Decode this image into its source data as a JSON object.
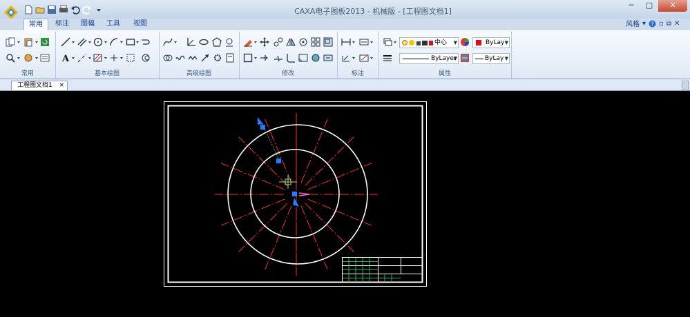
{
  "window": {
    "title": "CAXA电子图板2013 - 机械版 - [工程图文档1]",
    "minimize": "─",
    "maximize": "□",
    "close": "✕"
  },
  "quick_access": [
    "new-icon",
    "open-icon",
    "save-icon",
    "print-icon",
    "undo-icon",
    "redo-icon",
    "dropdown-icon"
  ],
  "tabs": [
    {
      "label": "常用",
      "active": true
    },
    {
      "label": "标注",
      "active": false
    },
    {
      "label": "图幅",
      "active": false
    },
    {
      "label": "工具",
      "active": false
    },
    {
      "label": "视图",
      "active": false
    }
  ],
  "style_menu": {
    "label": "风格",
    "help": "?"
  },
  "ribbon": {
    "groups": [
      {
        "label": "常用"
      },
      {
        "label": "基本绘图"
      },
      {
        "label": "高级绘图"
      },
      {
        "label": "修改"
      },
      {
        "label": "标注"
      },
      {
        "label": "属性"
      }
    ],
    "properties": {
      "layer_value": "中心",
      "color_value": "ByLay",
      "linetype_value": "ByLayer",
      "linewidth_value": "ByLay",
      "layer_color": "#e01010"
    }
  },
  "document_tab": {
    "label": "工程图文档1",
    "close": "×"
  },
  "colors": {
    "accent": "#15428b",
    "canvas": "#000000",
    "centerline": "#ff2a2a",
    "geometry": "#ffffff",
    "grip": "#1e7fff"
  }
}
